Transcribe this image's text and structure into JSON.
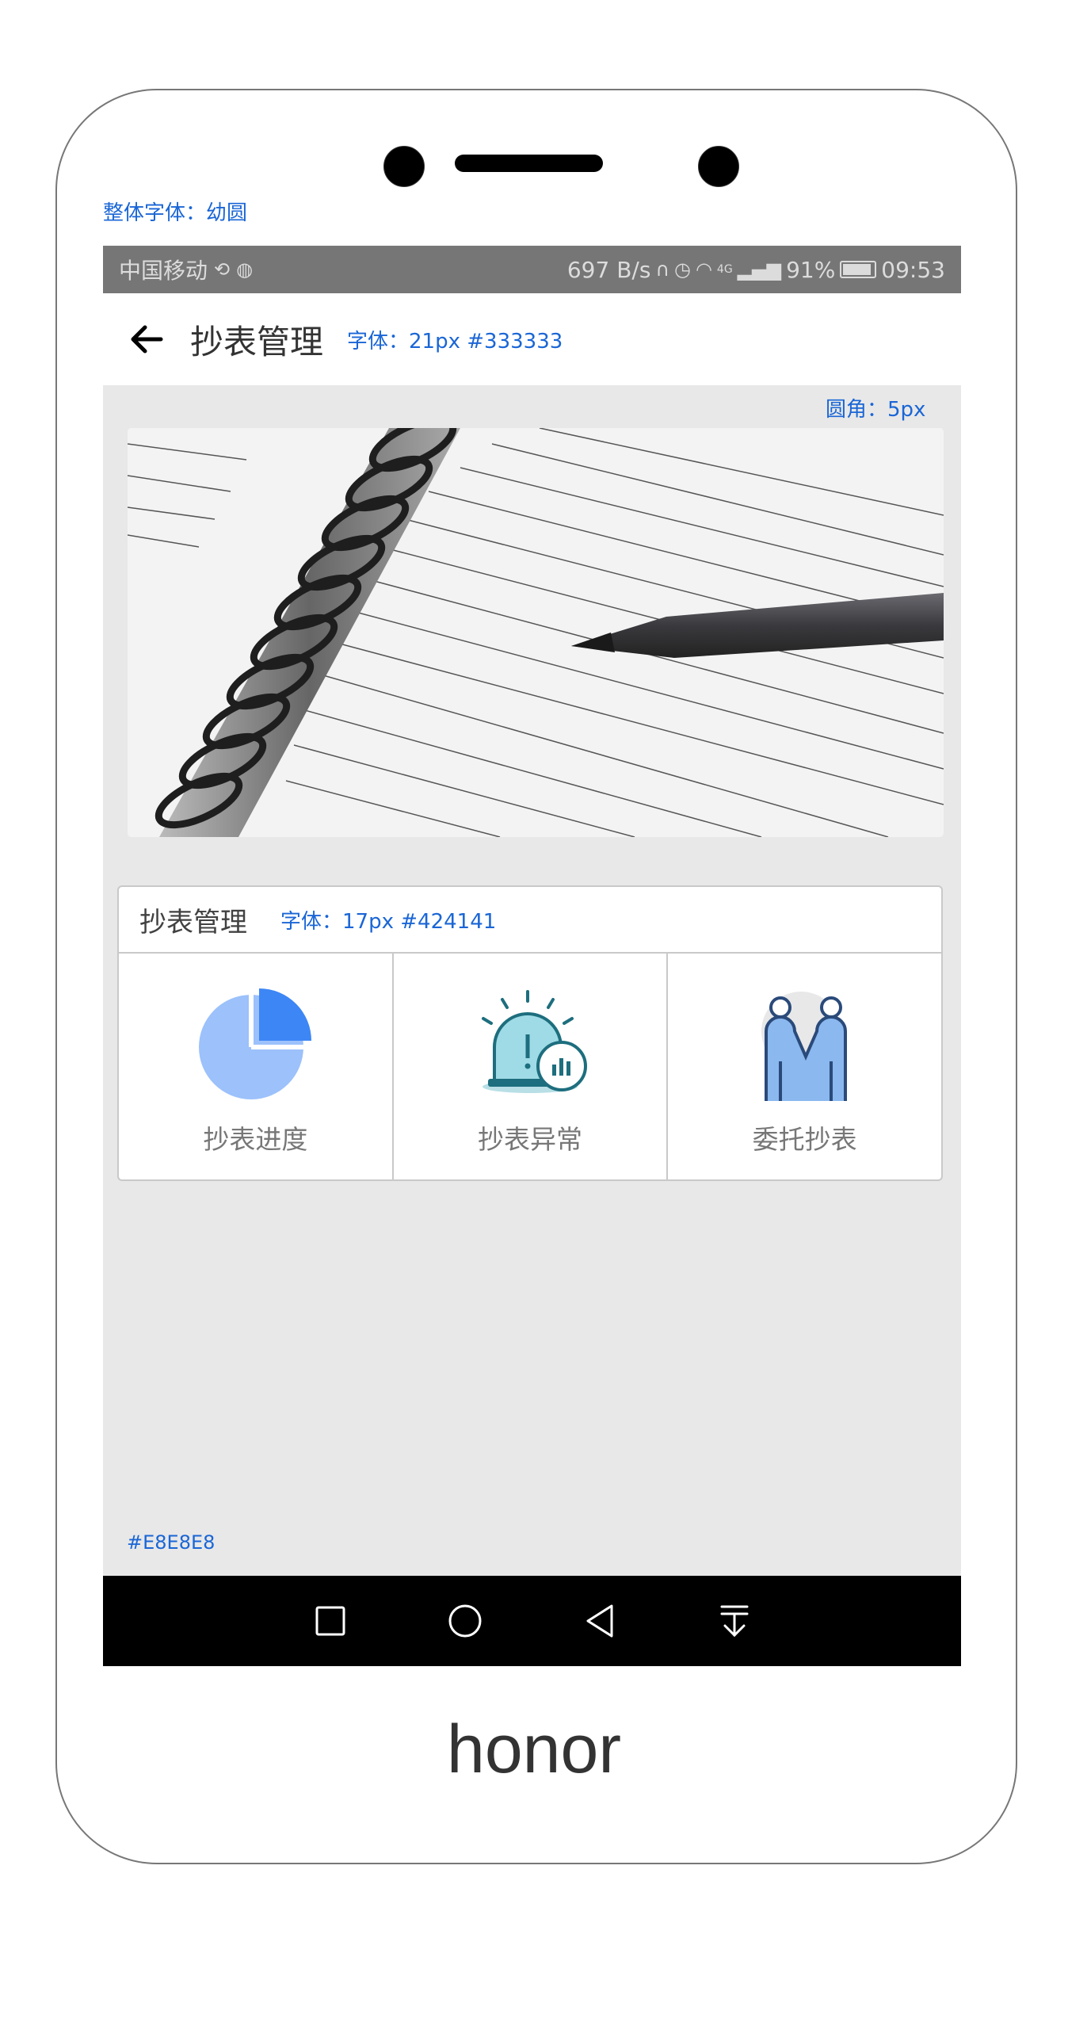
{
  "annotations": {
    "font_note": "整体字体：幼圆",
    "title_note": "字体：21px  #333333",
    "radius_note": "圆角：5px",
    "card_note": "字体：17px  #424141",
    "bg_note": "#E8E8E8"
  },
  "status_bar": {
    "carrier": "中国移动",
    "speed": "697 B/s",
    "signal": "4G",
    "battery": "91%",
    "battery_level": 0.91,
    "time": "09:53"
  },
  "header": {
    "title": "抄表管理"
  },
  "card": {
    "title": "抄表管理",
    "items": [
      {
        "label": "抄表进度",
        "icon": "pie-chart-icon"
      },
      {
        "label": "抄表异常",
        "icon": "alarm-icon"
      },
      {
        "label": "委托抄表",
        "icon": "handshake-icon"
      }
    ]
  },
  "nav": {
    "buttons": [
      "square-icon",
      "circle-icon",
      "triangle-back-icon",
      "download-icon"
    ]
  },
  "brand": "honor",
  "colors": {
    "accent": "#1a66d6",
    "title": "#333333",
    "card_title": "#424141",
    "background": "#E8E8E8"
  }
}
